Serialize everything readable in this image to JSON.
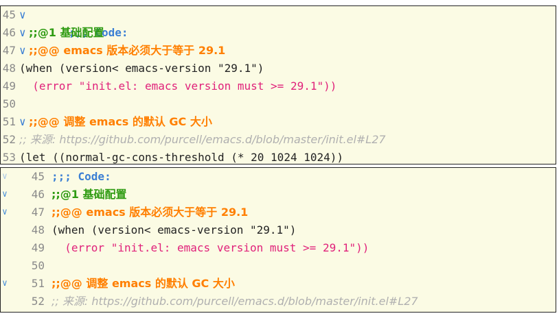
{
  "pane1": {
    "lines": [
      {
        "num": "45",
        "fold": "∨",
        "text": ";;; Code:"
      },
      {
        "num": "46",
        "fold": "∨",
        "text": ";;@1 基础配置"
      },
      {
        "num": "47",
        "fold": "∨",
        "text": ";;@@ emacs 版本必须大于等于 29.1"
      },
      {
        "num": "48",
        "fold": "",
        "text": "(when (version< emacs-version \"29.1\")"
      },
      {
        "num": "49",
        "fold": "",
        "text": "  (error \"init.el: emacs version must >= 29.1\"))"
      },
      {
        "num": "50",
        "fold": "",
        "text": ""
      },
      {
        "num": "51",
        "fold": "∨",
        "text": ";;@@ 调整 emacs 的默认 GC 大小"
      },
      {
        "num": "52",
        "fold": "",
        "text": ";; 来源: https://github.com/purcell/emacs.d/blob/master/init.el#L27"
      },
      {
        "num": "53",
        "fold": "",
        "text": "(let ((normal-gc-cons-threshold (* 20 1024 1024))"
      }
    ]
  },
  "pane2": {
    "lines": [
      {
        "num": "45",
        "fringe": "∨",
        "text": ";;; Code:"
      },
      {
        "num": "46",
        "fringe": "∨",
        "text": ";;@1 基础配置"
      },
      {
        "num": "47",
        "fringe": "∨",
        "text": ";;@@ emacs 版本必须大于等于 29.1"
      },
      {
        "num": "48",
        "fringe": "",
        "text": "(when (version< emacs-version \"29.1\")"
      },
      {
        "num": "49",
        "fringe": "",
        "text": "  (error \"init.el: emacs version must >= 29.1\"))"
      },
      {
        "num": "50",
        "fringe": "",
        "text": ""
      },
      {
        "num": "51",
        "fringe": "∨",
        "text": ";;@@ 调整 emacs 的默认 GC 大小"
      },
      {
        "num": "52",
        "fringe": "",
        "text": ";; 来源: https://github.com/purcell/emacs.d/blob/master/init.el#L27"
      }
    ]
  },
  "colors": {
    "background": "#fbfbe4",
    "heading1": "#2f9b12",
    "heading2": "#ff7f00",
    "heading3": "#3b7fd4",
    "keyword": "#2b7a0b",
    "error": "#c3003e",
    "string": "#e0217a",
    "comment": "#c6c6c6"
  }
}
